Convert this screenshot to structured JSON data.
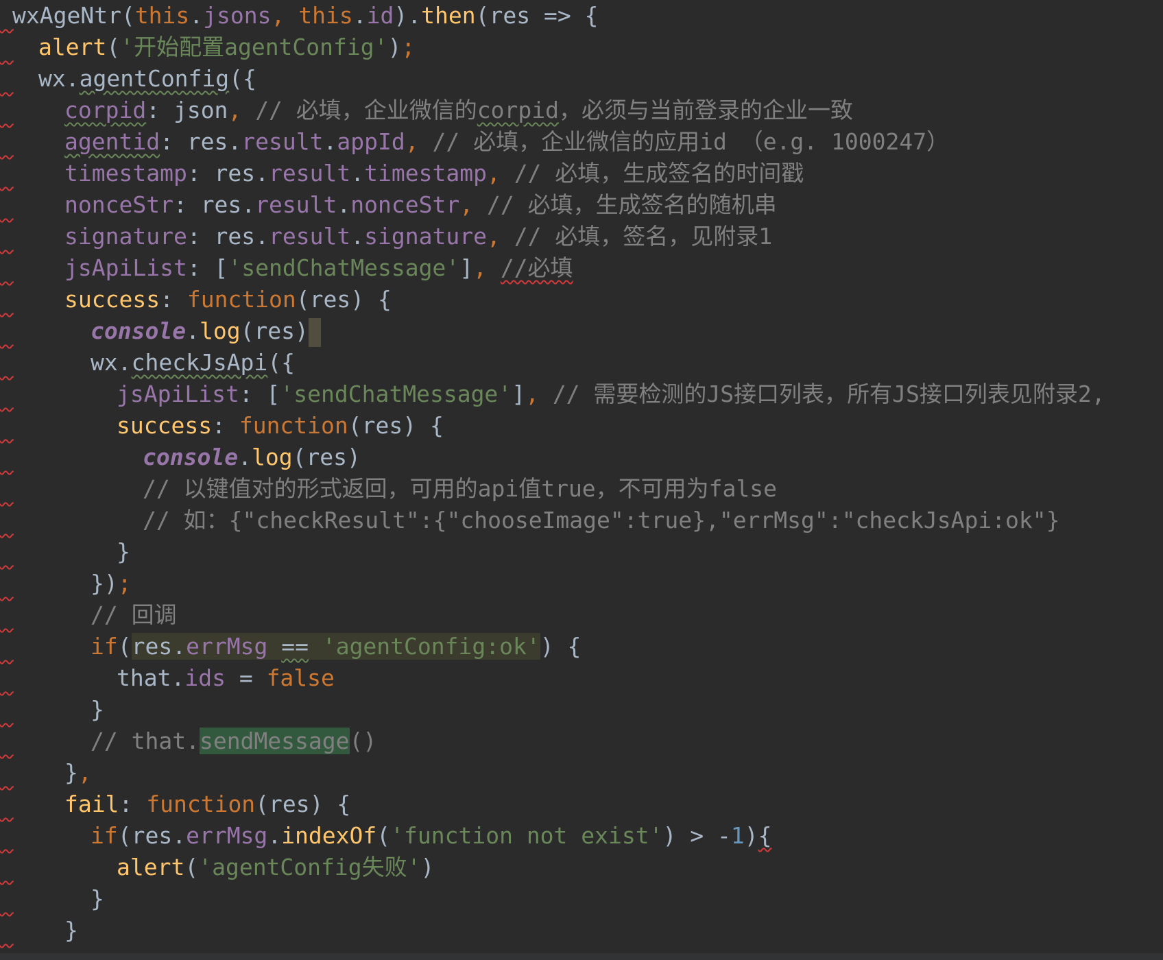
{
  "editor": {
    "theme_colors": {
      "background": "#2b2b2b",
      "keyword": "#cc7832",
      "property": "#9876aa",
      "string": "#6a8759",
      "comment": "#808080",
      "function": "#ffc66d",
      "number": "#6897bb",
      "default": "#a9b7c6",
      "error_squiggle": "#d03a3a"
    },
    "lines": [
      {
        "indent": 0,
        "tokens": [
          [
            "plain",
            "wxAgeNtr("
          ],
          [
            "kw",
            "this"
          ],
          [
            "plain",
            "."
          ],
          [
            "prop",
            "jsons"
          ],
          [
            "comma",
            ", "
          ],
          [
            "kw",
            "this"
          ],
          [
            "plain",
            "."
          ],
          [
            "prop",
            "id"
          ],
          [
            "plain",
            ")."
          ],
          [
            "fn",
            "then"
          ],
          [
            "plain",
            "(res => {"
          ]
        ]
      },
      {
        "indent": 1,
        "tokens": [
          [
            "fn",
            "alert"
          ],
          [
            "plain",
            "("
          ],
          [
            "str",
            "'开始配置agentConfig'"
          ],
          [
            "plain",
            ")"
          ],
          [
            "semi",
            ";"
          ]
        ]
      },
      {
        "indent": 1,
        "tokens": [
          [
            "plain",
            "wx."
          ],
          [
            "plain-u",
            "agentConfig"
          ],
          [
            "plain",
            "({"
          ]
        ]
      },
      {
        "indent": 2,
        "tokens": [
          [
            "prop-u",
            "corpid"
          ],
          [
            "plain",
            ": json"
          ],
          [
            "comma",
            ", "
          ],
          [
            "cmt",
            "// 必填，企业微信的"
          ],
          [
            "cmt-u",
            "corpid"
          ],
          [
            "cmt",
            "，必须与当前登录的企业一致"
          ]
        ]
      },
      {
        "indent": 2,
        "tokens": [
          [
            "prop-u",
            "agentid"
          ],
          [
            "plain",
            ": res."
          ],
          [
            "prop",
            "result"
          ],
          [
            "plain",
            "."
          ],
          [
            "prop",
            "appId"
          ],
          [
            "comma",
            ", "
          ],
          [
            "cmt",
            "// 必填，企业微信的应用id （e.g. 1000247）"
          ]
        ]
      },
      {
        "indent": 2,
        "tokens": [
          [
            "prop",
            "timestamp"
          ],
          [
            "plain",
            ": res."
          ],
          [
            "prop",
            "result"
          ],
          [
            "plain",
            "."
          ],
          [
            "prop",
            "timestamp"
          ],
          [
            "comma",
            ", "
          ],
          [
            "cmt",
            "// 必填，生成签名的时间戳"
          ]
        ]
      },
      {
        "indent": 2,
        "tokens": [
          [
            "prop",
            "nonceStr"
          ],
          [
            "plain",
            ": res."
          ],
          [
            "prop",
            "result"
          ],
          [
            "plain",
            "."
          ],
          [
            "prop",
            "nonceStr"
          ],
          [
            "comma",
            ", "
          ],
          [
            "cmt",
            "// 必填，生成签名的随机串"
          ]
        ]
      },
      {
        "indent": 2,
        "tokens": [
          [
            "prop",
            "signature"
          ],
          [
            "plain",
            ": res."
          ],
          [
            "prop",
            "result"
          ],
          [
            "plain",
            "."
          ],
          [
            "prop",
            "signature"
          ],
          [
            "comma",
            ", "
          ],
          [
            "cmt",
            "// 必填，签名，见附录1"
          ]
        ]
      },
      {
        "indent": 2,
        "tokens": [
          [
            "prop",
            "jsApiList"
          ],
          [
            "plain",
            ": ["
          ],
          [
            "str",
            "'sendChatMessage'"
          ],
          [
            "plain",
            "]"
          ],
          [
            "comma",
            ", "
          ],
          [
            "cmt-e",
            "//必填"
          ]
        ]
      },
      {
        "indent": 2,
        "tokens": [
          [
            "fn",
            "success"
          ],
          [
            "plain",
            ": "
          ],
          [
            "kw",
            "function"
          ],
          [
            "plain",
            "(res) {"
          ]
        ]
      },
      {
        "indent": 3,
        "tokens": [
          [
            "glob",
            "console"
          ],
          [
            "plain",
            "."
          ],
          [
            "fn",
            "log"
          ],
          [
            "plain",
            "(res)"
          ],
          [
            "caret",
            ""
          ]
        ]
      },
      {
        "indent": 3,
        "tokens": [
          [
            "plain",
            "wx."
          ],
          [
            "plain-u",
            "checkJsApi"
          ],
          [
            "plain",
            "({"
          ]
        ]
      },
      {
        "indent": 4,
        "tokens": [
          [
            "prop",
            "jsApiList"
          ],
          [
            "plain",
            ": ["
          ],
          [
            "str",
            "'sendChatMessage'"
          ],
          [
            "plain",
            "]"
          ],
          [
            "comma",
            ", "
          ],
          [
            "cmt",
            "// 需要检测的JS接口列表，所有JS接口列表见附录2,"
          ]
        ]
      },
      {
        "indent": 4,
        "tokens": [
          [
            "fn",
            "success"
          ],
          [
            "plain",
            ": "
          ],
          [
            "kw",
            "function"
          ],
          [
            "plain",
            "(res) {"
          ]
        ]
      },
      {
        "indent": 5,
        "tokens": [
          [
            "glob",
            "console"
          ],
          [
            "plain",
            "."
          ],
          [
            "fn",
            "log"
          ],
          [
            "plain",
            "(res)"
          ]
        ]
      },
      {
        "indent": 5,
        "tokens": [
          [
            "cmt",
            "// 以键值对的形式返回，可用的api值true，不可用为false"
          ]
        ]
      },
      {
        "indent": 5,
        "tokens": [
          [
            "cmt",
            "// 如：{\"checkResult\":{\"chooseImage\":true},\"errMsg\":\"checkJsApi:ok\"}"
          ]
        ]
      },
      {
        "indent": 4,
        "tokens": [
          [
            "plain",
            "}"
          ]
        ]
      },
      {
        "indent": 3,
        "tokens": [
          [
            "plain",
            "})"
          ],
          [
            "semi",
            ";"
          ]
        ]
      },
      {
        "indent": 3,
        "tokens": [
          [
            "cmt",
            "// 回调"
          ]
        ]
      },
      {
        "indent": 3,
        "tokens": [
          [
            "kw",
            "if"
          ],
          [
            "plain",
            "("
          ],
          [
            "plain-hl",
            "res."
          ],
          [
            "prop-hl",
            "errMsg"
          ],
          [
            "plain-hl",
            " "
          ],
          [
            "plain-hlu",
            "=="
          ],
          [
            "plain-hl",
            " "
          ],
          [
            "str-hl",
            "'agentConfig:ok'"
          ],
          [
            "plain",
            ") {"
          ]
        ]
      },
      {
        "indent": 4,
        "tokens": [
          [
            "plain",
            "that."
          ],
          [
            "prop",
            "ids"
          ],
          [
            "plain",
            " = "
          ],
          [
            "kw",
            "false"
          ]
        ]
      },
      {
        "indent": 3,
        "tokens": [
          [
            "plain",
            "}"
          ]
        ]
      },
      {
        "indent": 3,
        "tokens": [
          [
            "cmt",
            "// that."
          ],
          [
            "cmt-m",
            "sendMessage"
          ],
          [
            "cmt",
            "()"
          ]
        ]
      },
      {
        "indent": 2,
        "tokens": [
          [
            "plain",
            "}"
          ],
          [
            "comma",
            ","
          ]
        ]
      },
      {
        "indent": 2,
        "tokens": [
          [
            "fn",
            "fail"
          ],
          [
            "plain",
            ": "
          ],
          [
            "kw",
            "function"
          ],
          [
            "plain",
            "(res) {"
          ]
        ]
      },
      {
        "indent": 3,
        "tokens": [
          [
            "kw",
            "if"
          ],
          [
            "plain",
            "(res."
          ],
          [
            "prop",
            "errMsg"
          ],
          [
            "plain",
            "."
          ],
          [
            "fn",
            "indexOf"
          ],
          [
            "plain",
            "("
          ],
          [
            "str",
            "'function not exist'"
          ],
          [
            "plain",
            ") > -"
          ],
          [
            "num",
            "1"
          ],
          [
            "plain",
            ")"
          ],
          [
            "plain-e",
            "{"
          ]
        ]
      },
      {
        "indent": 4,
        "tokens": [
          [
            "fn",
            "alert"
          ],
          [
            "plain",
            "("
          ],
          [
            "str",
            "'agentConfig失败'"
          ],
          [
            "plain",
            ")"
          ]
        ]
      },
      {
        "indent": 3,
        "tokens": [
          [
            "plain",
            "}"
          ]
        ]
      },
      {
        "indent": 2,
        "tokens": [
          [
            "plain",
            "}"
          ]
        ]
      }
    ]
  }
}
